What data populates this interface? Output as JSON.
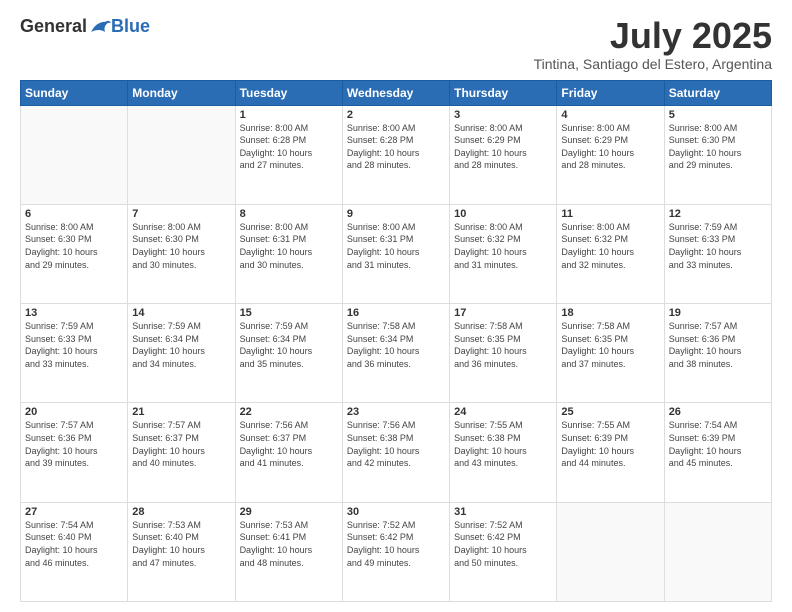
{
  "header": {
    "logo_general": "General",
    "logo_blue": "Blue",
    "month_title": "July 2025",
    "subtitle": "Tintina, Santiago del Estero, Argentina"
  },
  "days_of_week": [
    "Sunday",
    "Monday",
    "Tuesday",
    "Wednesday",
    "Thursday",
    "Friday",
    "Saturday"
  ],
  "weeks": [
    [
      {
        "num": "",
        "info": ""
      },
      {
        "num": "",
        "info": ""
      },
      {
        "num": "1",
        "info": "Sunrise: 8:00 AM\nSunset: 6:28 PM\nDaylight: 10 hours\nand 27 minutes."
      },
      {
        "num": "2",
        "info": "Sunrise: 8:00 AM\nSunset: 6:28 PM\nDaylight: 10 hours\nand 28 minutes."
      },
      {
        "num": "3",
        "info": "Sunrise: 8:00 AM\nSunset: 6:29 PM\nDaylight: 10 hours\nand 28 minutes."
      },
      {
        "num": "4",
        "info": "Sunrise: 8:00 AM\nSunset: 6:29 PM\nDaylight: 10 hours\nand 28 minutes."
      },
      {
        "num": "5",
        "info": "Sunrise: 8:00 AM\nSunset: 6:30 PM\nDaylight: 10 hours\nand 29 minutes."
      }
    ],
    [
      {
        "num": "6",
        "info": "Sunrise: 8:00 AM\nSunset: 6:30 PM\nDaylight: 10 hours\nand 29 minutes."
      },
      {
        "num": "7",
        "info": "Sunrise: 8:00 AM\nSunset: 6:30 PM\nDaylight: 10 hours\nand 30 minutes."
      },
      {
        "num": "8",
        "info": "Sunrise: 8:00 AM\nSunset: 6:31 PM\nDaylight: 10 hours\nand 30 minutes."
      },
      {
        "num": "9",
        "info": "Sunrise: 8:00 AM\nSunset: 6:31 PM\nDaylight: 10 hours\nand 31 minutes."
      },
      {
        "num": "10",
        "info": "Sunrise: 8:00 AM\nSunset: 6:32 PM\nDaylight: 10 hours\nand 31 minutes."
      },
      {
        "num": "11",
        "info": "Sunrise: 8:00 AM\nSunset: 6:32 PM\nDaylight: 10 hours\nand 32 minutes."
      },
      {
        "num": "12",
        "info": "Sunrise: 7:59 AM\nSunset: 6:33 PM\nDaylight: 10 hours\nand 33 minutes."
      }
    ],
    [
      {
        "num": "13",
        "info": "Sunrise: 7:59 AM\nSunset: 6:33 PM\nDaylight: 10 hours\nand 33 minutes."
      },
      {
        "num": "14",
        "info": "Sunrise: 7:59 AM\nSunset: 6:34 PM\nDaylight: 10 hours\nand 34 minutes."
      },
      {
        "num": "15",
        "info": "Sunrise: 7:59 AM\nSunset: 6:34 PM\nDaylight: 10 hours\nand 35 minutes."
      },
      {
        "num": "16",
        "info": "Sunrise: 7:58 AM\nSunset: 6:34 PM\nDaylight: 10 hours\nand 36 minutes."
      },
      {
        "num": "17",
        "info": "Sunrise: 7:58 AM\nSunset: 6:35 PM\nDaylight: 10 hours\nand 36 minutes."
      },
      {
        "num": "18",
        "info": "Sunrise: 7:58 AM\nSunset: 6:35 PM\nDaylight: 10 hours\nand 37 minutes."
      },
      {
        "num": "19",
        "info": "Sunrise: 7:57 AM\nSunset: 6:36 PM\nDaylight: 10 hours\nand 38 minutes."
      }
    ],
    [
      {
        "num": "20",
        "info": "Sunrise: 7:57 AM\nSunset: 6:36 PM\nDaylight: 10 hours\nand 39 minutes."
      },
      {
        "num": "21",
        "info": "Sunrise: 7:57 AM\nSunset: 6:37 PM\nDaylight: 10 hours\nand 40 minutes."
      },
      {
        "num": "22",
        "info": "Sunrise: 7:56 AM\nSunset: 6:37 PM\nDaylight: 10 hours\nand 41 minutes."
      },
      {
        "num": "23",
        "info": "Sunrise: 7:56 AM\nSunset: 6:38 PM\nDaylight: 10 hours\nand 42 minutes."
      },
      {
        "num": "24",
        "info": "Sunrise: 7:55 AM\nSunset: 6:38 PM\nDaylight: 10 hours\nand 43 minutes."
      },
      {
        "num": "25",
        "info": "Sunrise: 7:55 AM\nSunset: 6:39 PM\nDaylight: 10 hours\nand 44 minutes."
      },
      {
        "num": "26",
        "info": "Sunrise: 7:54 AM\nSunset: 6:39 PM\nDaylight: 10 hours\nand 45 minutes."
      }
    ],
    [
      {
        "num": "27",
        "info": "Sunrise: 7:54 AM\nSunset: 6:40 PM\nDaylight: 10 hours\nand 46 minutes."
      },
      {
        "num": "28",
        "info": "Sunrise: 7:53 AM\nSunset: 6:40 PM\nDaylight: 10 hours\nand 47 minutes."
      },
      {
        "num": "29",
        "info": "Sunrise: 7:53 AM\nSunset: 6:41 PM\nDaylight: 10 hours\nand 48 minutes."
      },
      {
        "num": "30",
        "info": "Sunrise: 7:52 AM\nSunset: 6:42 PM\nDaylight: 10 hours\nand 49 minutes."
      },
      {
        "num": "31",
        "info": "Sunrise: 7:52 AM\nSunset: 6:42 PM\nDaylight: 10 hours\nand 50 minutes."
      },
      {
        "num": "",
        "info": ""
      },
      {
        "num": "",
        "info": ""
      }
    ]
  ]
}
